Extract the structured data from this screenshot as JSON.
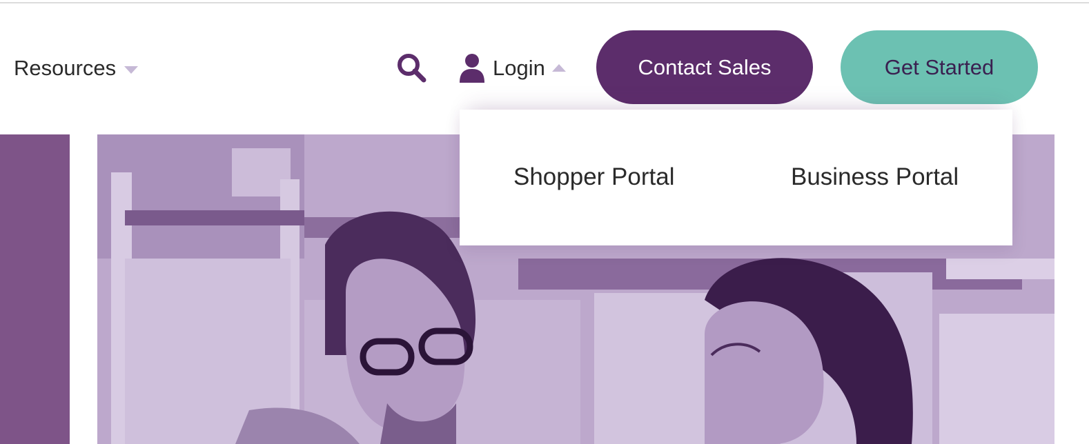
{
  "header": {
    "nav": {
      "resources_label": "Resources",
      "resources_icon": "caret-down-icon"
    },
    "search": {
      "icon": "search-icon"
    },
    "login": {
      "label": "Login",
      "icon": "user-icon",
      "caret": "caret-up-icon"
    },
    "buttons": {
      "contact_sales": "Contact Sales",
      "get_started": "Get Started"
    }
  },
  "login_dropdown": {
    "items": [
      {
        "label": "Shopper Portal"
      },
      {
        "label": "Business Portal"
      }
    ]
  },
  "colors": {
    "brand_purple": "#5c2d6b",
    "accent_teal": "#6cc1b2",
    "hero_tint": "#b9a4c9",
    "caret": "#c6b9d6"
  },
  "hero": {
    "image": "photo of two people talking in a warehouse with purple tint"
  }
}
